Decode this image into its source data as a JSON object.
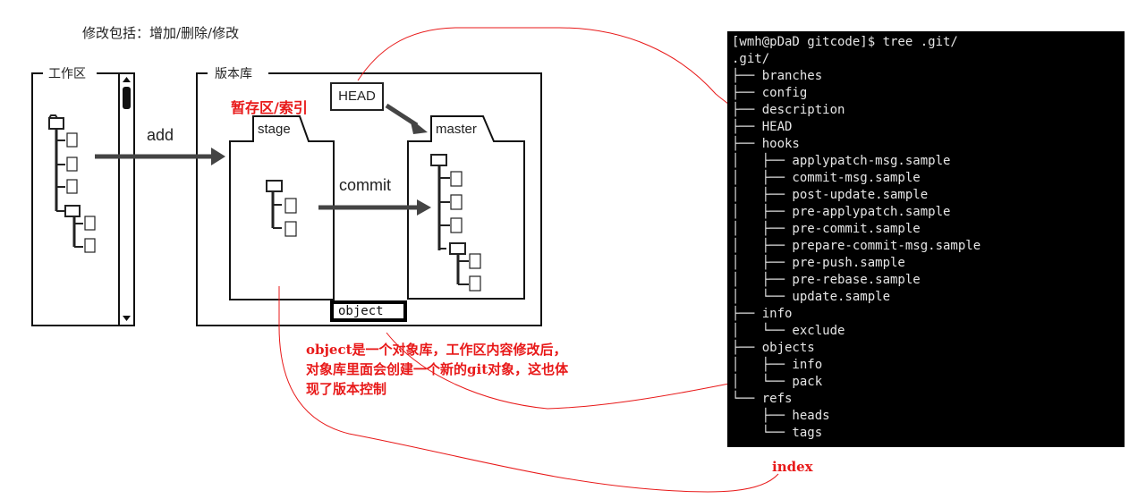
{
  "heading": "修改包括：增加/删除/修改",
  "diagram": {
    "workspace_label": "工作区",
    "repository_label": "版本库",
    "stage_annotation": "暂存区/索引",
    "stage_tab": "stage",
    "master_tab": "master",
    "head_box": "HEAD",
    "add_label": "add",
    "commit_label": "commit",
    "object_box": "object"
  },
  "annotation": {
    "note": "object是一个对象库，工作区内容修改后，对象库里面会创建一个新的git对象，这也体现了版本控制",
    "index_label": "index",
    "color": "#e81919"
  },
  "terminal": {
    "prompt": "[wmh@pDaD gitcode]$ tree .git/",
    "lines": [
      ".git/",
      "├── branches",
      "├── config",
      "├── description",
      "├── HEAD",
      "├── hooks",
      "│   ├── applypatch-msg.sample",
      "│   ├── commit-msg.sample",
      "│   ├── post-update.sample",
      "│   ├── pre-applypatch.sample",
      "│   ├── pre-commit.sample",
      "│   ├── prepare-commit-msg.sample",
      "│   ├── pre-push.sample",
      "│   ├── pre-rebase.sample",
      "│   └── update.sample",
      "├── info",
      "│   └── exclude",
      "├── objects",
      "│   ├── info",
      "│   └── pack",
      "└── refs",
      "    ├── heads",
      "    └── tags"
    ]
  }
}
